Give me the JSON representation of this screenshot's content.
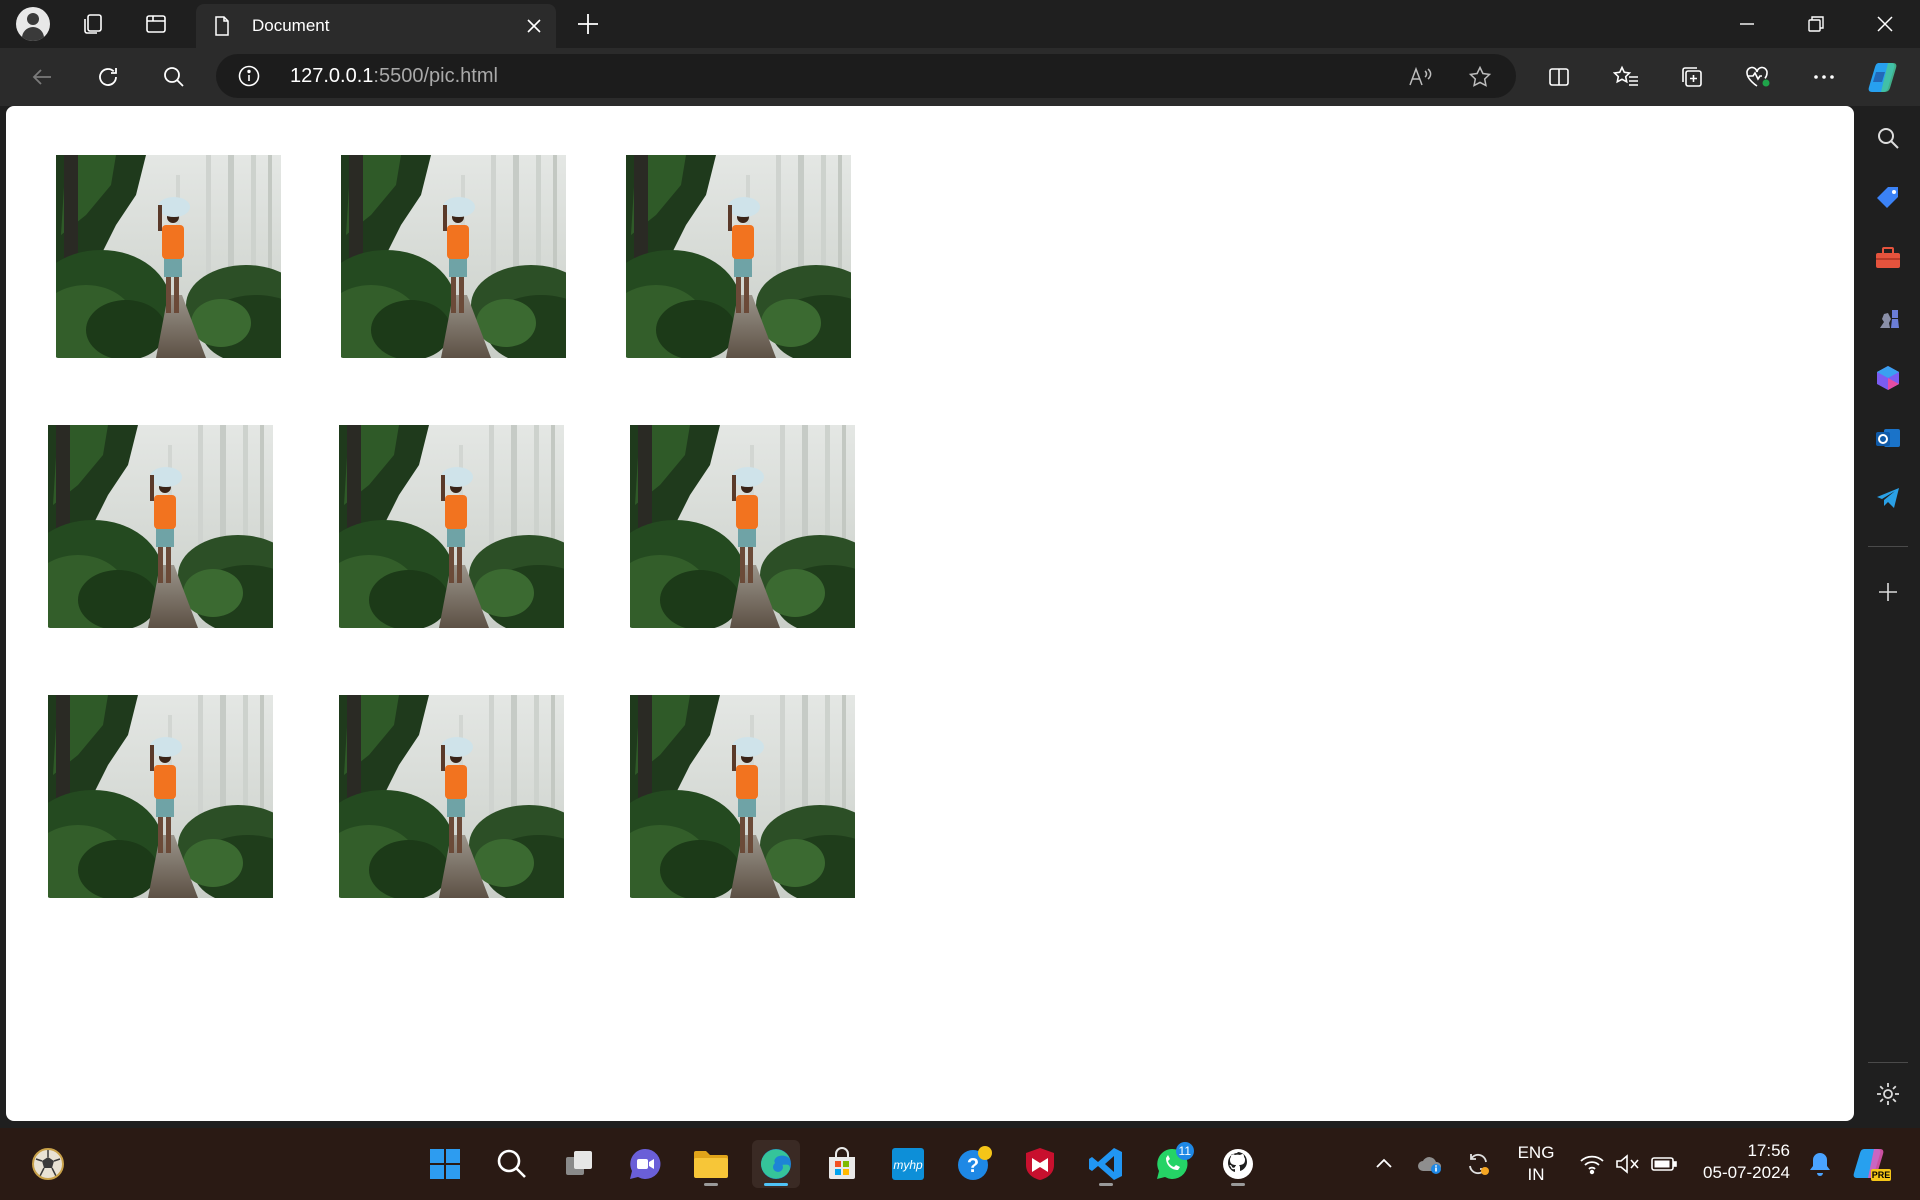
{
  "browser": {
    "tab": {
      "title": "Document"
    },
    "address": {
      "host": "127.0.0.1",
      "rest": ":5500/pic.html"
    }
  },
  "page": {
    "images": [
      {
        "alt": "forest-path-photo"
      },
      {
        "alt": "forest-path-photo"
      },
      {
        "alt": "forest-path-photo"
      },
      {
        "alt": "forest-path-photo"
      },
      {
        "alt": "forest-path-photo"
      },
      {
        "alt": "forest-path-photo"
      },
      {
        "alt": "forest-path-photo"
      },
      {
        "alt": "forest-path-photo"
      },
      {
        "alt": "forest-path-photo"
      }
    ]
  },
  "taskbar": {
    "whatsapp_badge": "11",
    "lang_primary": "ENG",
    "lang_secondary": "IN",
    "time": "17:56",
    "date": "05-07-2024"
  },
  "colors": {
    "accent": "#4fc3f7",
    "tab_bg": "#2b2b2b",
    "frame_bg": "#1f1f1f",
    "taskbar_bg": "#2a1a14"
  }
}
